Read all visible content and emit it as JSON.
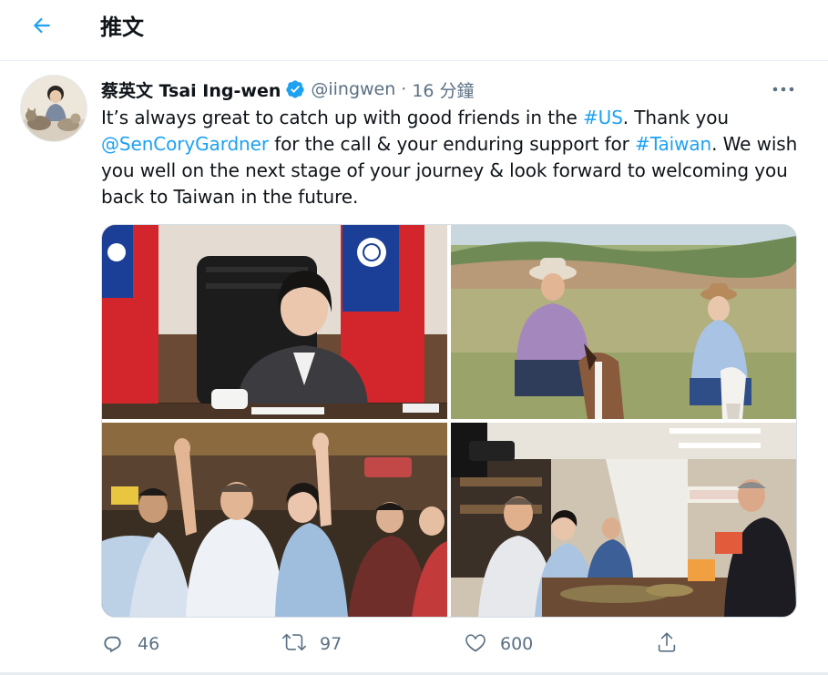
{
  "header": {
    "title": "推文",
    "back_icon": "arrow-left-icon",
    "accent": "#1da1f2"
  },
  "tweet": {
    "author_name": "蔡英文 Tsai Ing-wen",
    "verified": true,
    "handle": "@iingwen",
    "separator": "·",
    "time": "16 分鐘",
    "text_parts": {
      "t1": "It’s always great to catch up with good friends in the ",
      "l1": "#US",
      "t2": ". Thank you ",
      "l2": "@SenCoryGardner",
      "t3": " for the call & your enduring support for ",
      "l3": "#Taiwan",
      "t4": ". We wish you well on the next stage of your journey & look forward to welcoming you back to Taiwan in the future."
    },
    "media": [
      {
        "name": "photo-video-call"
      },
      {
        "name": "photo-horseback-riding"
      },
      {
        "name": "photo-crowd-waving"
      },
      {
        "name": "photo-shop-visit"
      }
    ]
  },
  "actions": {
    "reply": {
      "icon": "reply-icon",
      "count": "46"
    },
    "retweet": {
      "icon": "retweet-icon",
      "count": "97"
    },
    "like": {
      "icon": "heart-icon",
      "count": "600"
    },
    "share": {
      "icon": "share-icon"
    }
  },
  "colors": {
    "text": "#0f1419",
    "secondary": "#5b7083",
    "link": "#1da1f2",
    "border": "#e6ecf0"
  }
}
